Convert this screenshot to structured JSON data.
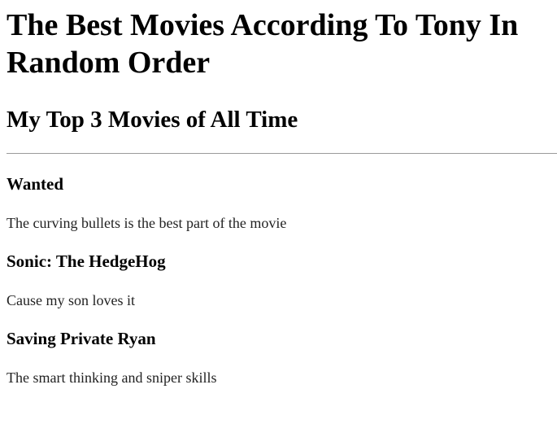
{
  "page": {
    "title": "The Best Movies According To Tony In Random Order",
    "subtitle": "My Top 3 Movies of All Time"
  },
  "movies": [
    {
      "name": "Wanted",
      "reason": "The curving bullets is the best part of the movie"
    },
    {
      "name": "Sonic: The HedgeHog",
      "reason": "Cause my son loves it"
    },
    {
      "name": "Saving Private Ryan",
      "reason": "The smart thinking and sniper skills"
    }
  ]
}
